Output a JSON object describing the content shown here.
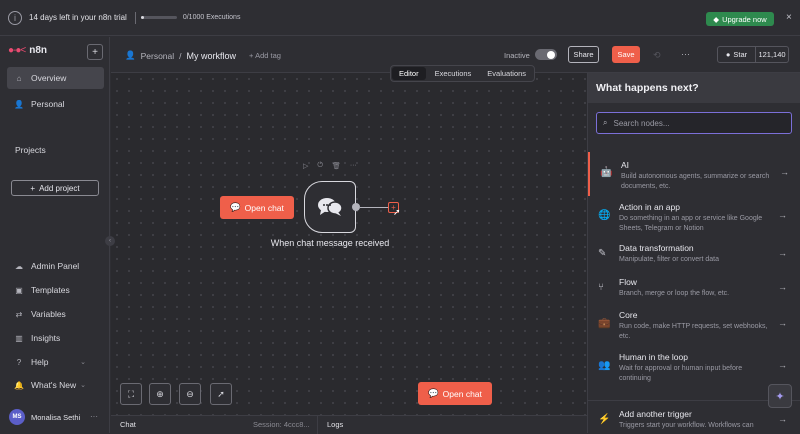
{
  "banner": {
    "trial_text": "14 days left in your n8n trial",
    "executions_text": "0/1000 Executions",
    "executions_used_fraction": 0.0,
    "upgrade_label": "Upgrade now",
    "close_glyph": "×"
  },
  "sidebar": {
    "logo_text": "n8n",
    "add_glyph": "+",
    "items": [
      {
        "label": "Overview",
        "icon": "home-icon",
        "glyph": "⌂"
      },
      {
        "label": "Personal",
        "icon": "user-icon",
        "glyph": "👤"
      }
    ],
    "projects_label": "Projects",
    "add_project_label": "Add project",
    "bottom_items": [
      {
        "label": "Admin Panel",
        "icon": "cloud-icon",
        "glyph": "☁"
      },
      {
        "label": "Templates",
        "icon": "templates-icon",
        "glyph": "▣"
      },
      {
        "label": "Variables",
        "icon": "variables-icon",
        "glyph": "⇄"
      },
      {
        "label": "Insights",
        "icon": "insights-icon",
        "glyph": "▥"
      },
      {
        "label": "Help",
        "icon": "help-icon",
        "glyph": "?"
      },
      {
        "label": "What's New",
        "icon": "bell-icon",
        "glyph": "🔔"
      }
    ],
    "user": {
      "initials": "MS",
      "name": "Monalisa Sethi",
      "more_glyph": "···"
    }
  },
  "header": {
    "breadcrumb_project": "Personal",
    "breadcrumb_sep": "/",
    "workflow_name": "My workflow",
    "add_tag_label": "+ Add tag",
    "status_label": "Inactive",
    "share_label": "Share",
    "save_label": "Save",
    "more_glyph": "···",
    "star_label": "Star",
    "star_count": "121,140"
  },
  "tabs": [
    {
      "label": "Editor",
      "active": true
    },
    {
      "label": "Executions",
      "active": false
    },
    {
      "label": "Evaluations",
      "active": false
    }
  ],
  "canvas": {
    "open_chat_label": "Open chat",
    "node_label": "When chat message received",
    "node_tools": [
      "▷",
      "⏻",
      "🗑",
      "···"
    ],
    "controls": [
      {
        "name": "fit-view-button",
        "glyph": "⛶"
      },
      {
        "name": "zoom-in-button",
        "glyph": "⊕"
      },
      {
        "name": "zoom-out-button",
        "glyph": "⊖"
      },
      {
        "name": "tidy-up-button",
        "glyph": "➚"
      }
    ],
    "bottom_open_chat_label": "Open chat"
  },
  "bottom_bar": {
    "chat_label": "Chat",
    "session_label": "Session: 4ccc8...",
    "logs_label": "Logs"
  },
  "panel": {
    "title": "What happens next?",
    "search_placeholder": "Search nodes...",
    "items": [
      {
        "title": "AI",
        "desc": "Build autonomous agents, summarize or search documents, etc.",
        "icon": "robot-icon",
        "glyph": "🤖"
      },
      {
        "title": "Action in an app",
        "desc": "Do something in an app or service like Google Sheets, Telegram or Notion",
        "icon": "globe-icon",
        "glyph": "🌐"
      },
      {
        "title": "Data transformation",
        "desc": "Manipulate, filter or convert data",
        "icon": "pen-icon",
        "glyph": "✎"
      },
      {
        "title": "Flow",
        "desc": "Branch, merge or loop the flow, etc.",
        "icon": "branch-icon",
        "glyph": "⑂"
      },
      {
        "title": "Core",
        "desc": "Run code, make HTTP requests, set webhooks, etc.",
        "icon": "briefcase-icon",
        "glyph": "💼"
      },
      {
        "title": "Human in the loop",
        "desc": "Wait for approval or human input before continuing",
        "icon": "human-icon",
        "glyph": "👥"
      },
      {
        "title": "Add another trigger",
        "desc": "Triggers start your workflow. Workflows can",
        "icon": "bolt-icon",
        "glyph": "⚡"
      }
    ],
    "arrow_glyph": "→"
  },
  "colors": {
    "accent": "#ef5f4a",
    "upgrade": "#2e8a4e",
    "focus": "#7b6fd8"
  }
}
